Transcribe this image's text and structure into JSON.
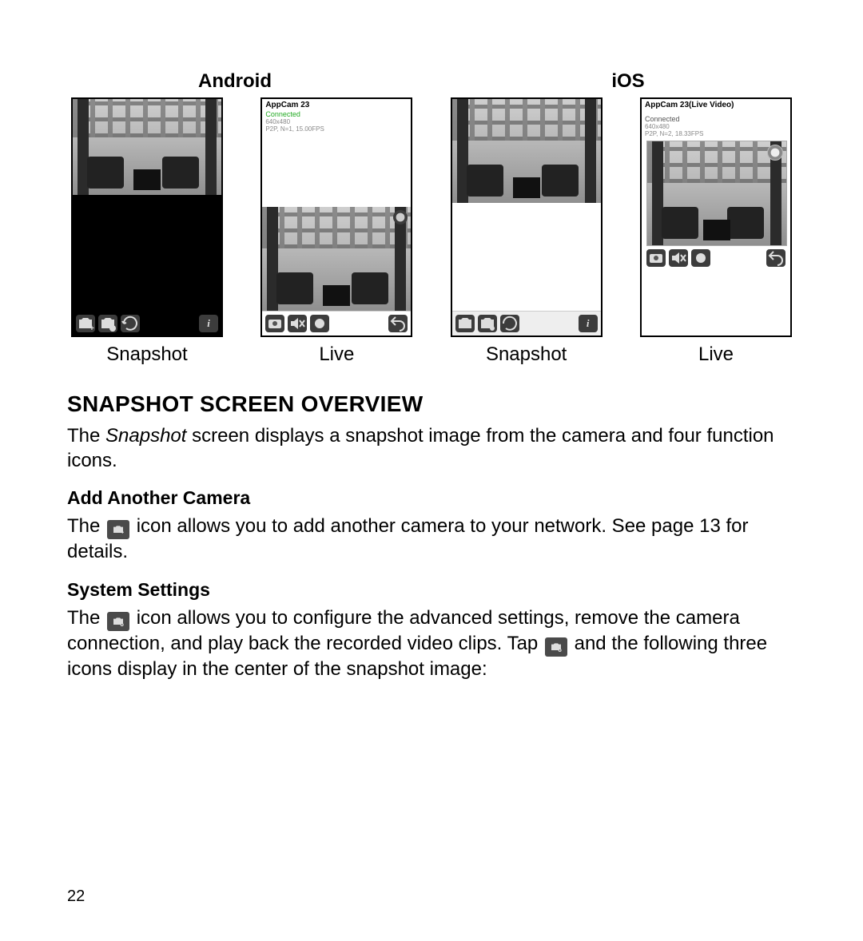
{
  "platforms": {
    "android": "Android",
    "ios": "iOS"
  },
  "captions": {
    "snapshot": "Snapshot",
    "live": "Live"
  },
  "screens": {
    "android_live": {
      "title": "AppCam 23",
      "status": "Connected",
      "res": "640x480",
      "fps": "P2P, N=1, 15.00FPS"
    },
    "ios_live": {
      "title": "AppCam 23(Live Video)",
      "status": "Connected",
      "res": "640x480",
      "fps": "P2P, N=2, 18.33FPS"
    }
  },
  "headings": {
    "overview": "Snapshot Screen Overview",
    "add_camera": "Add Another Camera",
    "system_settings": "System Settings"
  },
  "body": {
    "overview_1a": "The ",
    "overview_1b_italic": "Snapshot",
    "overview_1c": " screen displays a snapshot image from the camera and four function icons.",
    "add_camera_pre": "The ",
    "add_camera_post": " icon allows you to add another camera to your network. See page 13 for details.",
    "settings_pre": "The ",
    "settings_mid": " icon allows you to configure the advanced settings, remove the camera connection, and play back the recorded video clips. Tap ",
    "settings_post": " and the following three icons display in the center of the snapshot image:"
  },
  "page_number": "22",
  "icons": {
    "add_camera": "camera-plus-icon",
    "settings": "camera-gear-icon",
    "refresh": "refresh-icon",
    "info": "info-icon",
    "snapshot_btn": "camera-icon",
    "mute": "mute-icon",
    "record": "record-icon",
    "back": "back-icon"
  }
}
